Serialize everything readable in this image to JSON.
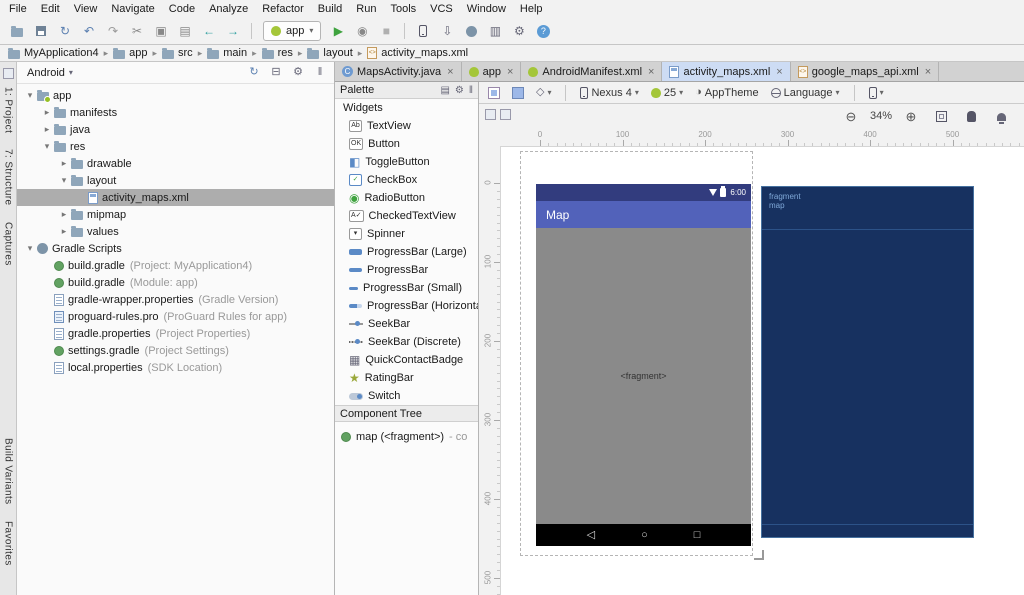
{
  "menu": {
    "items": [
      "File",
      "Edit",
      "View",
      "Navigate",
      "Code",
      "Analyze",
      "Refactor",
      "Build",
      "Run",
      "Tools",
      "VCS",
      "Window",
      "Help"
    ]
  },
  "toolbar": {
    "left_icons": [
      "open-folder",
      "save",
      "sync",
      "undo",
      "redo",
      "cut",
      "copy",
      "paste",
      "back-arrow",
      "forward-arrow"
    ],
    "run_config": {
      "icon": "android",
      "label": "app"
    },
    "run_icons": [
      "run",
      "profile",
      "stop"
    ],
    "right_icons": [
      "avd-manager",
      "sdk-manager",
      "gradle-sync",
      "layout-inspector",
      "settings",
      "help"
    ]
  },
  "breadcrumbs": {
    "items": [
      {
        "icon": "folder",
        "label": "MyApplication4"
      },
      {
        "icon": "folder",
        "label": "app"
      },
      {
        "icon": "folder",
        "label": "src"
      },
      {
        "icon": "folder",
        "label": "main"
      },
      {
        "icon": "folder",
        "label": "res"
      },
      {
        "icon": "folder",
        "label": "layout"
      },
      {
        "icon": "xml-file",
        "label": "activity_maps.xml"
      }
    ]
  },
  "left_strip": {
    "top": [
      "1: Project",
      "7: Structure",
      "Captures"
    ],
    "bottom": [
      "Build Variants",
      "Favorites"
    ]
  },
  "project_panel": {
    "view": "Android",
    "header_icons": [
      "sync",
      "collapse-all",
      "settings",
      "hide-panel"
    ],
    "tree": [
      {
        "d": 0,
        "arrow": "open",
        "icon": "folder-android",
        "label": "app"
      },
      {
        "d": 1,
        "arrow": "closed",
        "icon": "folder",
        "label": "manifests"
      },
      {
        "d": 1,
        "arrow": "closed",
        "icon": "folder",
        "label": "java"
      },
      {
        "d": 1,
        "arrow": "open",
        "icon": "folder",
        "label": "res"
      },
      {
        "d": 2,
        "arrow": "closed",
        "icon": "folder",
        "label": "drawable"
      },
      {
        "d": 2,
        "arrow": "open",
        "icon": "folder",
        "label": "layout"
      },
      {
        "d": 3,
        "arrow": null,
        "icon": "layout-file",
        "label": "activity_maps.xml",
        "sel": true
      },
      {
        "d": 2,
        "arrow": "closed",
        "icon": "folder",
        "label": "mipmap"
      },
      {
        "d": 2,
        "arrow": "closed",
        "icon": "folder",
        "label": "values"
      },
      {
        "d": 0,
        "arrow": "open",
        "icon": "gradle",
        "label": "Gradle Scripts"
      },
      {
        "d": 1,
        "arrow": null,
        "icon": "gradle-file",
        "label": "build.gradle",
        "note": "(Project: MyApplication4)"
      },
      {
        "d": 1,
        "arrow": null,
        "icon": "gradle-file",
        "label": "build.gradle",
        "note": "(Module: app)"
      },
      {
        "d": 1,
        "arrow": null,
        "icon": "properties-file",
        "label": "gradle-wrapper.properties",
        "note": "(Gradle Version)"
      },
      {
        "d": 1,
        "arrow": null,
        "icon": "proguard-file",
        "label": "proguard-rules.pro",
        "note": "(ProGuard Rules for app)"
      },
      {
        "d": 1,
        "arrow": null,
        "icon": "properties-file",
        "label": "gradle.properties",
        "note": "(Project Properties)"
      },
      {
        "d": 1,
        "arrow": null,
        "icon": "gradle-file",
        "label": "settings.gradle",
        "note": "(Project Settings)"
      },
      {
        "d": 1,
        "arrow": null,
        "icon": "properties-file",
        "label": "local.properties",
        "note": "(SDK Location)"
      }
    ]
  },
  "editor_tabs": [
    {
      "icon": "class-file",
      "label": "MapsActivity.java"
    },
    {
      "icon": "android",
      "label": "app"
    },
    {
      "icon": "manifest-file",
      "label": "AndroidManifest.xml"
    },
    {
      "icon": "layout-file",
      "label": "activity_maps.xml",
      "active": true
    },
    {
      "icon": "xml-file",
      "label": "google_maps_api.xml"
    }
  ],
  "palette": {
    "title": "Palette",
    "header_icons": [
      "grid-view",
      "settings",
      "hide-panel"
    ],
    "category": "Widgets",
    "items": [
      {
        "icon": "textview",
        "label": "TextView"
      },
      {
        "icon": "button",
        "label": "Button"
      },
      {
        "icon": "togglebutton",
        "label": "ToggleButton"
      },
      {
        "icon": "checkbox",
        "label": "CheckBox"
      },
      {
        "icon": "radiobutton",
        "label": "RadioButton"
      },
      {
        "icon": "checkedtextview",
        "label": "CheckedTextView"
      },
      {
        "icon": "spinner",
        "label": "Spinner"
      },
      {
        "icon": "progressbar-large",
        "label": "ProgressBar (Large)"
      },
      {
        "icon": "progressbar",
        "label": "ProgressBar"
      },
      {
        "icon": "progressbar-small",
        "label": "ProgressBar (Small)"
      },
      {
        "icon": "progressbar-horizontal",
        "label": "ProgressBar (Horizontal)"
      },
      {
        "icon": "seekbar",
        "label": "SeekBar"
      },
      {
        "icon": "seekbar-discrete",
        "label": "SeekBar (Discrete)"
      },
      {
        "icon": "quickcontactbadge",
        "label": "QuickContactBadge"
      },
      {
        "icon": "ratingbar",
        "label": "RatingBar"
      },
      {
        "icon": "switch",
        "label": "Switch"
      }
    ]
  },
  "component_tree": {
    "title": "Component Tree",
    "items": [
      {
        "icon": "fragment",
        "label": "map (<fragment>)",
        "note": "- co"
      }
    ]
  },
  "designer": {
    "toolbar": {
      "items": [
        {
          "icon": "design-mode"
        },
        {
          "icon": "blueprint-mode"
        },
        {
          "icon": "orientation",
          "arrow": true
        },
        {
          "sep": true
        },
        {
          "icon": "device",
          "name": "device-selector",
          "label": "Nexus 4",
          "arrow": true
        },
        {
          "icon": "android",
          "name": "api-selector",
          "label": "25",
          "arrow": true
        },
        {
          "icon": "theme",
          "name": "theme-selector",
          "label": "AppTheme"
        },
        {
          "icon": "language",
          "name": "language-selector",
          "label": "Language",
          "arrow": true
        },
        {
          "sep": true
        },
        {
          "icon": "device",
          "name": "orientation-selector",
          "arrow": true
        }
      ]
    },
    "surface_toggles": [
      "surface-toggle",
      "surface-toggle"
    ],
    "zoom": {
      "level": "34%",
      "pre_icons": [
        "zoom-out"
      ],
      "post_icons": [
        "zoom-in",
        "zoom-fit",
        "pan-tool",
        "notifications"
      ]
    },
    "ruler_top": [
      "0",
      "100",
      "200",
      "300",
      "400",
      "500"
    ],
    "ruler_left": [
      "0",
      "100",
      "200",
      "300",
      "400",
      "500"
    ],
    "device_preview": {
      "title": "Map",
      "time": "6:00",
      "content": "<fragment>",
      "status_icons": [
        "wifi",
        "battery"
      ],
      "nav_icons": [
        "nav-back",
        "nav-home",
        "nav-recents"
      ]
    },
    "blueprint": {
      "line1": "fragment",
      "line2": "map"
    }
  },
  "colors": {
    "statusbar": "#323c7e",
    "appbar": "#5262ba",
    "content_gray": "#8a8a8a",
    "blueprint_bg": "#173160",
    "blueprint_line": "#2c5288",
    "blueprint_text": "#7fa8d8",
    "selection": "#adadad",
    "tab_active": "#cddcf4"
  }
}
